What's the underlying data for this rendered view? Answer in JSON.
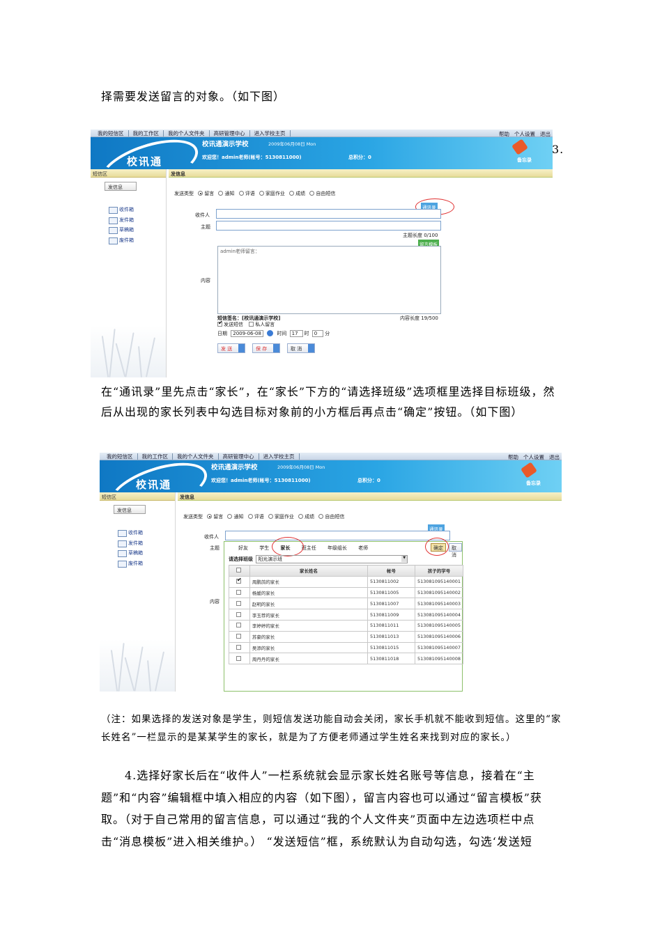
{
  "doc": {
    "p1": "择需要发送留言的对象。（如下图）",
    "p2": "在“通讯录”里先点击“家长”，在“家长”下方的“请选择班级”选项框里选择目标班级，然后从出现的家长列表中勾选目标对象前的小方框后再点击“确定”按钮。（如下图）",
    "note": "（注：如果选择的发送对象是学生，则短信发送功能自动会关闭，家长手机就不能收到短信。这里的“家长姓名”一栏显示的是某某学生的家长，就是为了方便老师通过学生姓名来找到对应的家长。）",
    "p4": "4.选择好家长后在“收件人”一栏系统就会显示家长姓名账号等信息，接着在“主题”和“内容”编辑框中填入相应的内容（如下图），留言内容也可以通过“留言模板”获取。（对于自己常用的留言信息，可以通过“我的个人文件夹”页面中左边选项栏中点击“消息模板”进入相关维护。） “发送短信”框，系统默认为自动勾选，勾选‘发送短",
    "marker": "3."
  },
  "app": {
    "nav": [
      "我的短信区",
      "我的工作区",
      "我的个人文件夹",
      "高研管理中心",
      "进入学校主页"
    ],
    "nav_right": [
      "帮助",
      "个人设置",
      "退出"
    ],
    "school": "校讯通演示学校",
    "date": "2009年06月08日 Mon",
    "welcome": "欢迎您！admin老师(帐号：5130811000)",
    "score": "总积分：0",
    "logo": "校讯通",
    "memo": "备忘录",
    "left_head": "短信区",
    "main_head": "发信息",
    "send_btn": "发信息",
    "folders": [
      "收件箱",
      "发件箱",
      "草稿箱",
      "废件箱"
    ],
    "send_type_label": "发送类型",
    "send_types": [
      "留言",
      "通知",
      "评语",
      "家庭作业",
      "成绩",
      "自由短信"
    ],
    "addr_book": "通讯录",
    "recipient": "收件人",
    "subject": "主题",
    "subject_len": "主题长度 0/100",
    "template": "留言模板",
    "content": "内容",
    "content_default": "admin老师留言：",
    "signature": "短信签名：[校讯通演示学校]",
    "content_len": "内容长度 19/500",
    "send_sms": "发送短信",
    "private": "私人留言",
    "date_label": "日期",
    "date_val": "2009-06-08",
    "time_label": "时间",
    "hour": "17",
    "hour_unit": "时",
    "minute": "0",
    "minute_unit": "分",
    "btn_send": "发 送",
    "btn_save": "保 存",
    "btn_cancel": "取 消"
  },
  "picker": {
    "tabs": [
      "好友",
      "学生",
      "家长",
      "班主任",
      "年级组长",
      "老师"
    ],
    "confirm": "确定",
    "cancel": "取消",
    "class_label": "请选择班级",
    "class_val": "阳光演示班",
    "headers": [
      "家长姓名",
      "帐号",
      "孩子的学号"
    ],
    "rows": [
      {
        "name": "周鹏鸽的家长",
        "acct": "5130811002",
        "sid": "513081095140001",
        "checked": true
      },
      {
        "name": "杨媛的家长",
        "acct": "5130811005",
        "sid": "513081095140002",
        "checked": false
      },
      {
        "name": "赵明的家长",
        "acct": "5130811007",
        "sid": "513081095140003",
        "checked": false
      },
      {
        "name": "李玉荐的家长",
        "acct": "5130811009",
        "sid": "513081095140004",
        "checked": false
      },
      {
        "name": "李婷婷的家长",
        "acct": "5130811011",
        "sid": "513081095140005",
        "checked": false
      },
      {
        "name": "苏豪的家长",
        "acct": "5130811013",
        "sid": "513081095140006",
        "checked": false
      },
      {
        "name": "吴添的家长",
        "acct": "5130811015",
        "sid": "513081095140007",
        "checked": false
      },
      {
        "name": "周丹丹的家长",
        "acct": "5130811018",
        "sid": "513081095140008",
        "checked": false
      }
    ]
  }
}
